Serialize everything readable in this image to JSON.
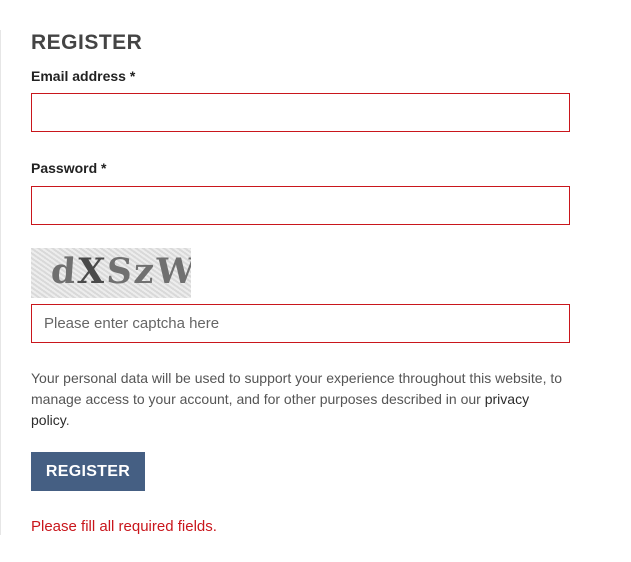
{
  "form": {
    "title": "REGISTER",
    "email_label": "Email address *",
    "email_value": "",
    "password_label": "Password *",
    "password_value": "",
    "captcha_text_part1": "d",
    "captcha_text_part2": "X",
    "captcha_text_part3": "SzW",
    "captcha_placeholder": "Please enter captcha here",
    "privacy_text": "Your personal data will be used to support your experience throughout this website, to manage access to your account, and for other purposes described in our ",
    "privacy_link": "privacy policy",
    "privacy_end": ".",
    "submit_label": "REGISTER",
    "error_message": "Please fill all required fields."
  },
  "colors": {
    "error_red": "#c9161c",
    "button_blue": "#455f83"
  }
}
